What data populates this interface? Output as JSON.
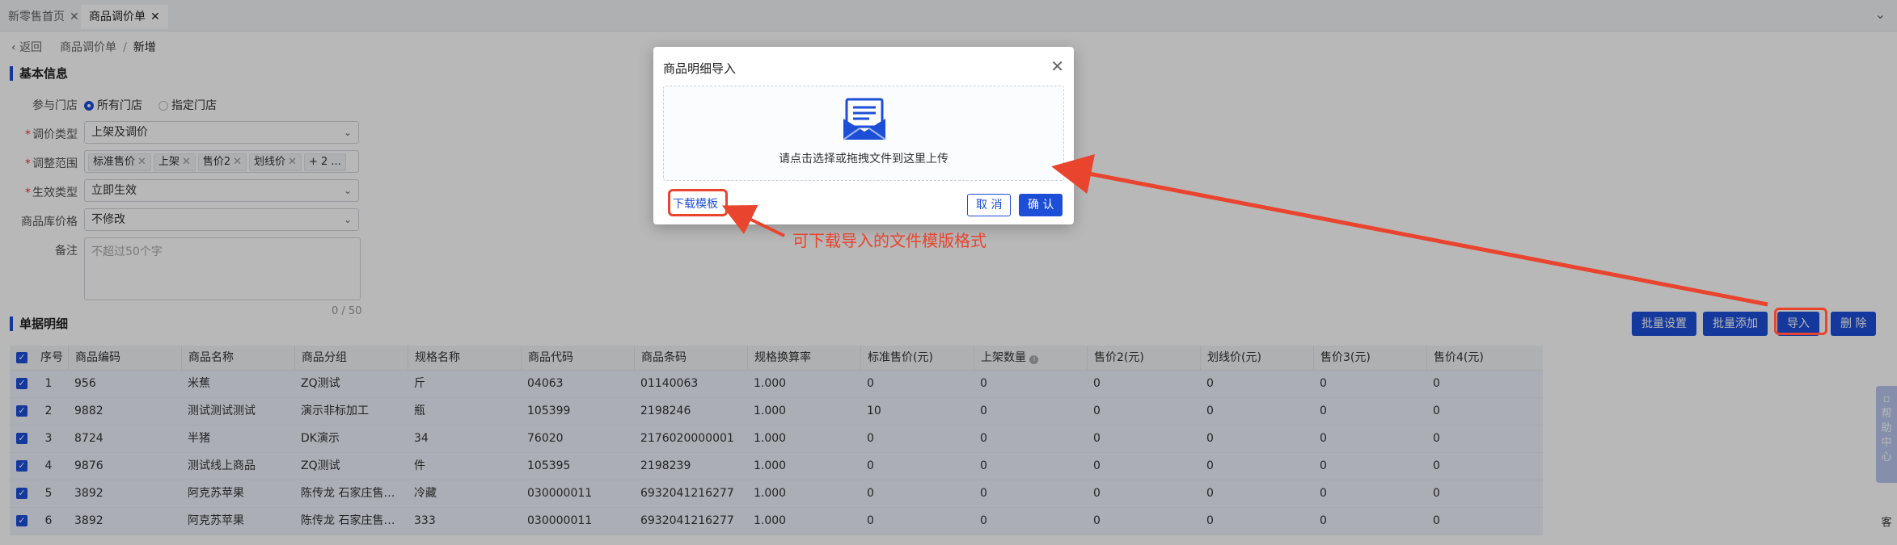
{
  "tabs": [
    {
      "label": "新零售首页",
      "active": false
    },
    {
      "label": "商品调价单",
      "active": true
    }
  ],
  "breadcrumb": {
    "back": "返回",
    "parent": "商品调价单",
    "separator": "/",
    "current": "新增"
  },
  "basic_info": {
    "title": "基本信息",
    "store_label": "参与门店",
    "store_options": [
      "所有门店",
      "指定门店"
    ],
    "adjust_type_label": "调价类型",
    "adjust_type_value": "上架及调价",
    "scope_label": "调整范围",
    "scope_chips": [
      "标准售价",
      "上架",
      "售价2",
      "划线价"
    ],
    "scope_more": "+ 2 ...",
    "effect_label": "生效类型",
    "effect_value": "立即生效",
    "stock_price_label": "商品库价格",
    "stock_price_value": "不修改",
    "note_label": "备注",
    "note_placeholder": "不超过50个字",
    "note_counter": "0 / 50"
  },
  "detail": {
    "title": "单据明细",
    "buttons": {
      "batch_set": "批量设置",
      "batch_add": "批量添加",
      "import": "导入",
      "delete": "删 除"
    },
    "columns": [
      "序号",
      "商品编码",
      "商品名称",
      "商品分组",
      "规格名称",
      "商品代码",
      "商品条码",
      "规格换算率",
      "标准售价(元)",
      "上架数量",
      "售价2(元)",
      "划线价(元)",
      "售价3(元)",
      "售价4(元)"
    ],
    "rows": [
      [
        "1",
        "956",
        "米蕉",
        "ZQ测试",
        "斤",
        "04063",
        "01140063",
        "1.000",
        "0",
        "0",
        "0",
        "0",
        "0",
        "0"
      ],
      [
        "2",
        "9882",
        "测试测试测试",
        "演示非标加工",
        "瓶",
        "105399",
        "2198246",
        "1.000",
        "10",
        "0",
        "0",
        "0",
        "0",
        "0"
      ],
      [
        "3",
        "8724",
        "半猪",
        "DK演示",
        "34",
        "76020",
        "2176020000001",
        "1.000",
        "0",
        "0",
        "0",
        "0",
        "0",
        "0"
      ],
      [
        "4",
        "9876",
        "测试线上商品",
        "ZQ测试",
        "件",
        "105395",
        "2198239",
        "1.000",
        "0",
        "0",
        "0",
        "0",
        "0",
        "0"
      ],
      [
        "5",
        "3892",
        "阿克苏苹果",
        "陈传龙 石家庄售…",
        "冷藏",
        "030000011",
        "6932041216277",
        "1.000",
        "0",
        "0",
        "0",
        "0",
        "0",
        "0"
      ],
      [
        "6",
        "3892",
        "阿克苏苹果",
        "陈传龙 石家庄售…",
        "333",
        "030000011",
        "6932041216277",
        "1.000",
        "0",
        "0",
        "0",
        "0",
        "0",
        "0"
      ]
    ]
  },
  "modal": {
    "title": "商品明细导入",
    "dropzone_text": "请点击选择或拖拽文件到这里上传",
    "download_template": "下载模板",
    "cancel": "取 消",
    "ok": "确 认"
  },
  "annotation": {
    "text": "可下载导入的文件模版格式",
    "color": "#e8442e"
  },
  "side": {
    "help": [
      "帮",
      "助",
      "中",
      "心"
    ],
    "service": "客"
  },
  "colors": {
    "primary": "#1d4ed8",
    "annotation": "#e8442e"
  },
  "icons": {
    "tab_close": "✕",
    "back": "‹",
    "collapse": "⌄",
    "dropdown": "⌄",
    "modal_close": "✕",
    "check": "✓"
  }
}
